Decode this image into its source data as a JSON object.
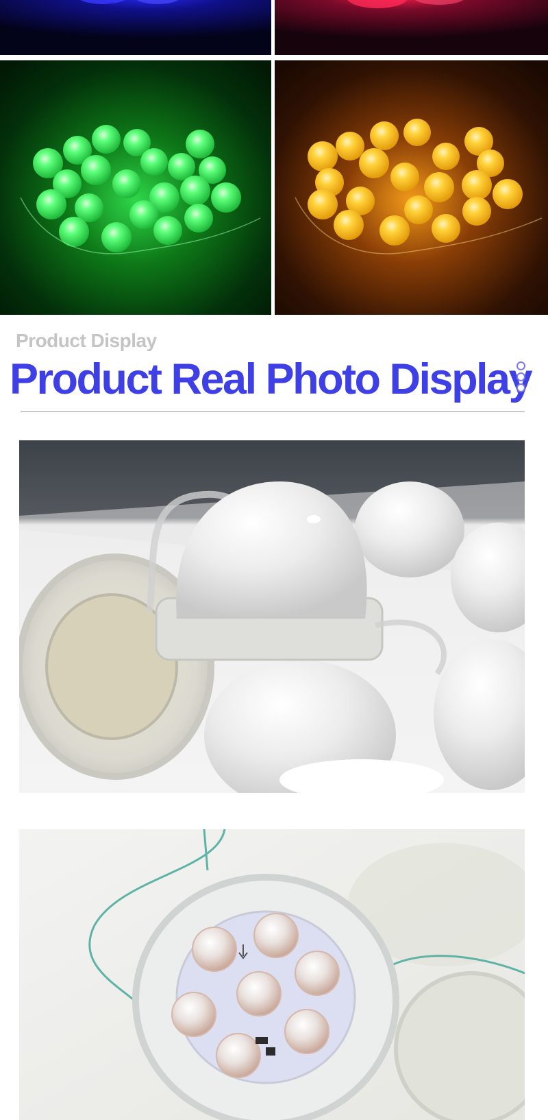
{
  "gallery": {
    "tiles": [
      {
        "name": "blue",
        "glow": "#1a1adf",
        "bg": "#05051c"
      },
      {
        "name": "red",
        "glow": "#ff2255",
        "bg": "#1c0510"
      },
      {
        "name": "green",
        "glow": "#3dff6a",
        "bg": "#042a08"
      },
      {
        "name": "amber",
        "glow": "#ffc21a",
        "bg": "#1e0c02"
      }
    ]
  },
  "section": {
    "subtitle": "Product Display",
    "title": "Product Real Photo Display",
    "accent": "#3f3fe6"
  },
  "photos": [
    {
      "subject": "frosted-dome-pixel-lights"
    },
    {
      "subject": "led-module-with-7-lenses"
    }
  ]
}
